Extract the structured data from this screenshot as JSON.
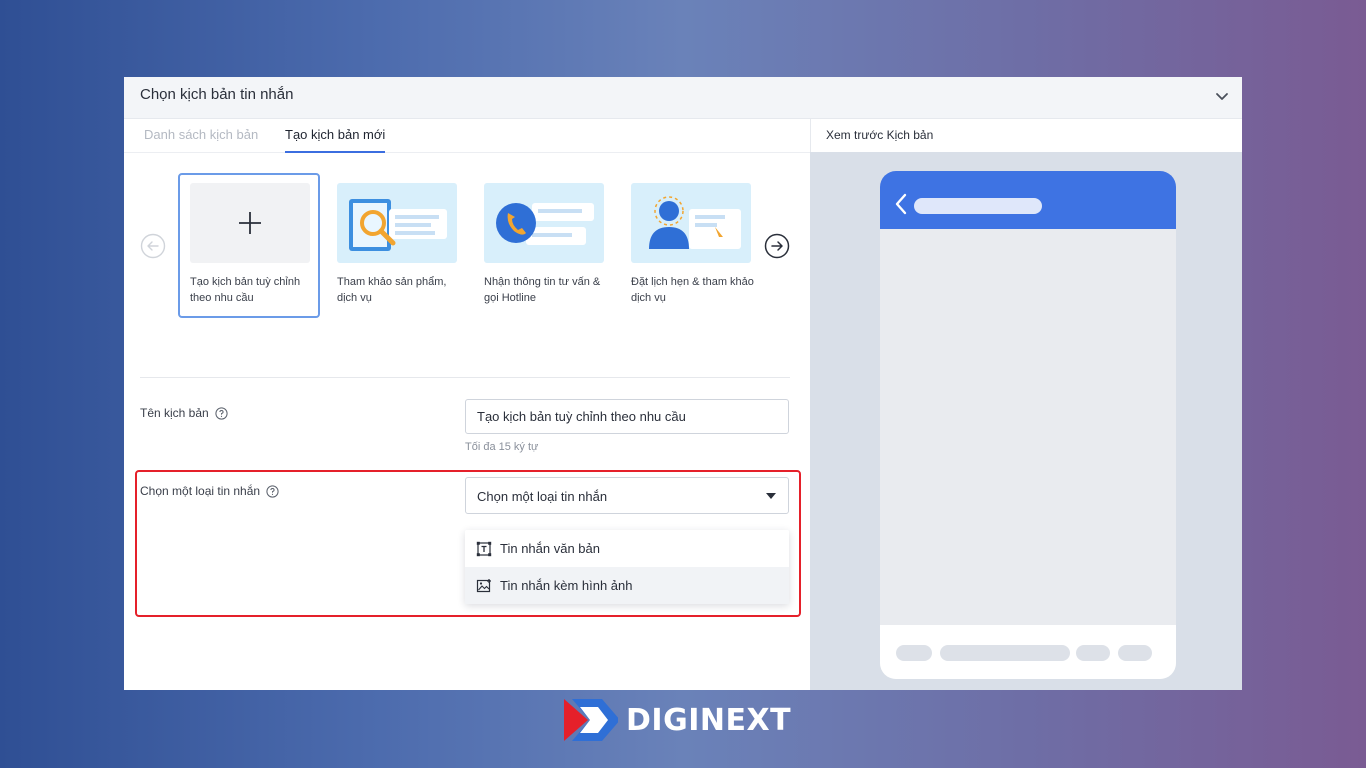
{
  "header": {
    "title": "Chọn kịch bản tin nhắn",
    "collapse_icon": "chevron-down-icon"
  },
  "tabs": [
    {
      "label": "Danh sách kịch bản",
      "active": false
    },
    {
      "label": "Tạo kịch bản mới",
      "active": true
    }
  ],
  "templates": [
    {
      "label": "Tạo kịch bản tuỳ chỉnh theo nhu cầu",
      "icon": "plus-icon",
      "selected": true
    },
    {
      "label": "Tham khảo sản phẩm, dịch vụ",
      "icon": "search-illustration"
    },
    {
      "label": "Nhận thông tin tư vấn & gọi Hotline",
      "icon": "phone-illustration"
    },
    {
      "label": "Đặt lịch hẹn & tham khảo dịch vụ",
      "icon": "person-illustration"
    }
  ],
  "form": {
    "name_label": "Tên kịch bản",
    "name_value": "Tạo kịch bản tuỳ chỉnh theo nhu cầu",
    "name_hint": "Tối đa 15 ký tự",
    "type_label": "Chọn một loại tin nhắn",
    "type_value": "Chọn một loại tin nhắn",
    "type_options": [
      {
        "label": "Tin nhắn văn bản",
        "icon": "text-icon"
      },
      {
        "label": "Tin nhắn kèm hình ảnh",
        "icon": "image-icon"
      }
    ]
  },
  "preview": {
    "title": "Xem trước Kịch bản"
  },
  "brand": {
    "name": "DIGINEXT",
    "accent": "#3e73e3",
    "highlight": "#e5202a"
  }
}
